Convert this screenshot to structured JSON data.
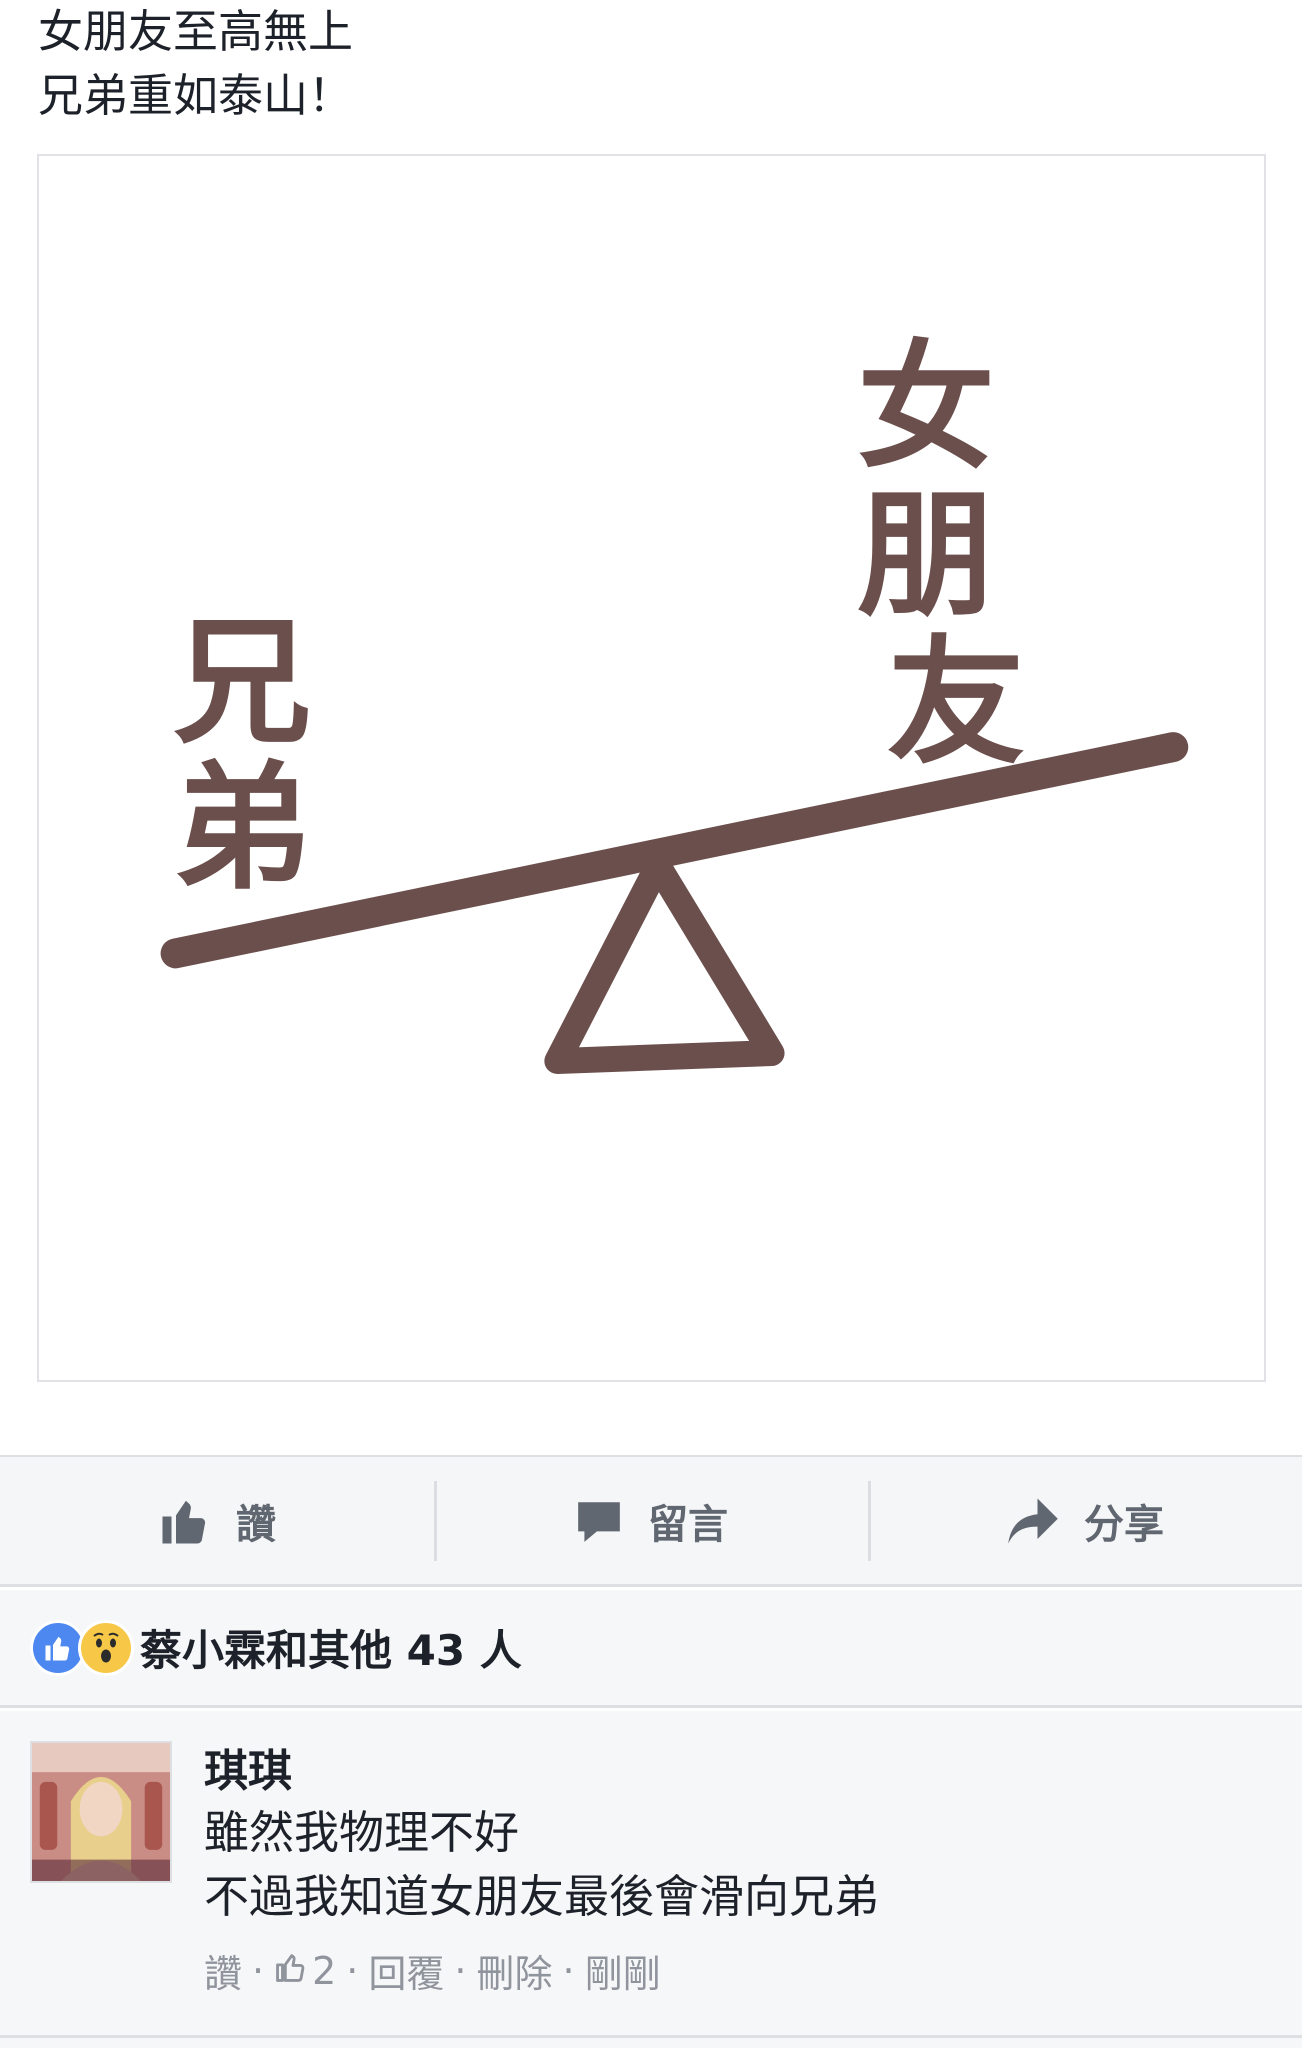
{
  "post": {
    "text_lines": [
      "女朋友至高無上",
      "兄弟重如泰山！"
    ],
    "image": {
      "left_word": [
        "兄",
        "弟"
      ],
      "right_word": [
        "女",
        "朋",
        "友"
      ],
      "ink_color": "#6b4f4c"
    }
  },
  "actions": {
    "like_label": "讚",
    "comment_label": "留言",
    "share_label": "分享",
    "icon_color": "#606770"
  },
  "reactions": {
    "summary": "蔡小霖和其他 43 人",
    "types": [
      "like",
      "wow"
    ]
  },
  "comment": {
    "author": "琪琪",
    "text_lines": [
      "雖然我物理不好",
      "不過我知道女朋友最後會滑向兄弟"
    ],
    "meta": {
      "like_label": "讚",
      "like_count": "2",
      "reply_label": "回覆",
      "delete_label": "刪除",
      "time": "剛剛"
    }
  }
}
